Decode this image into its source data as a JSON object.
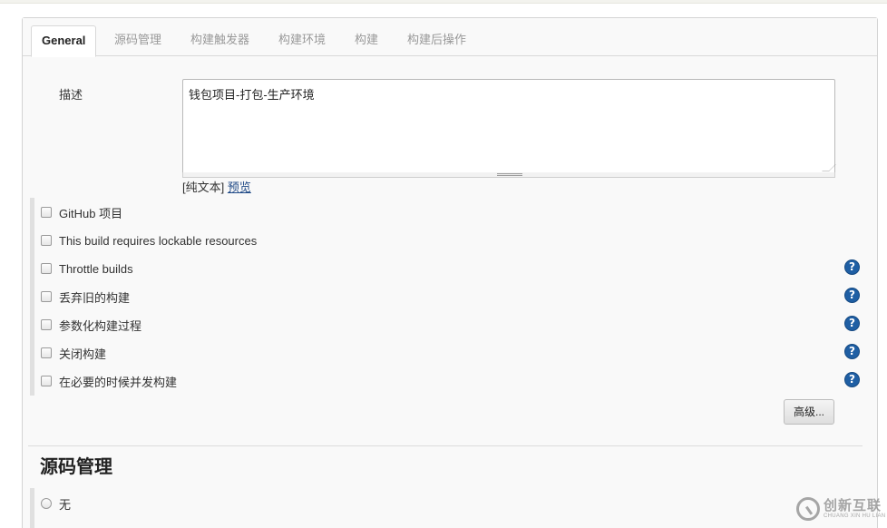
{
  "tabs": [
    {
      "label": "General",
      "active": true
    },
    {
      "label": "源码管理",
      "active": false
    },
    {
      "label": "构建触发器",
      "active": false
    },
    {
      "label": "构建环境",
      "active": false
    },
    {
      "label": "构建",
      "active": false
    },
    {
      "label": "构建后操作",
      "active": false
    }
  ],
  "description": {
    "label": "描述",
    "value": "钱包项目-打包-生产环境",
    "plain_text": "[纯文本]",
    "preview_link": "预览"
  },
  "options": [
    {
      "label": "GitHub 项目",
      "checked": false,
      "help": false
    },
    {
      "label": "This build requires lockable resources",
      "checked": false,
      "help": false
    },
    {
      "label": "Throttle builds",
      "checked": false,
      "help": true
    },
    {
      "label": "丢弃旧的构建",
      "checked": false,
      "help": true
    },
    {
      "label": "参数化构建过程",
      "checked": false,
      "help": true
    },
    {
      "label": "关闭构建",
      "checked": false,
      "help": true
    },
    {
      "label": "在必要的时候并发构建",
      "checked": false,
      "help": true
    }
  ],
  "help_icon": {
    "glyph": "?",
    "color": "#1f5fa4"
  },
  "advanced_button": "高级...",
  "scm_section": {
    "title": "源码管理",
    "options": [
      {
        "label": "无",
        "selected": false
      }
    ]
  },
  "watermark": {
    "cn": "创新互联",
    "en": "CHUANG XIN HU LIAN"
  }
}
